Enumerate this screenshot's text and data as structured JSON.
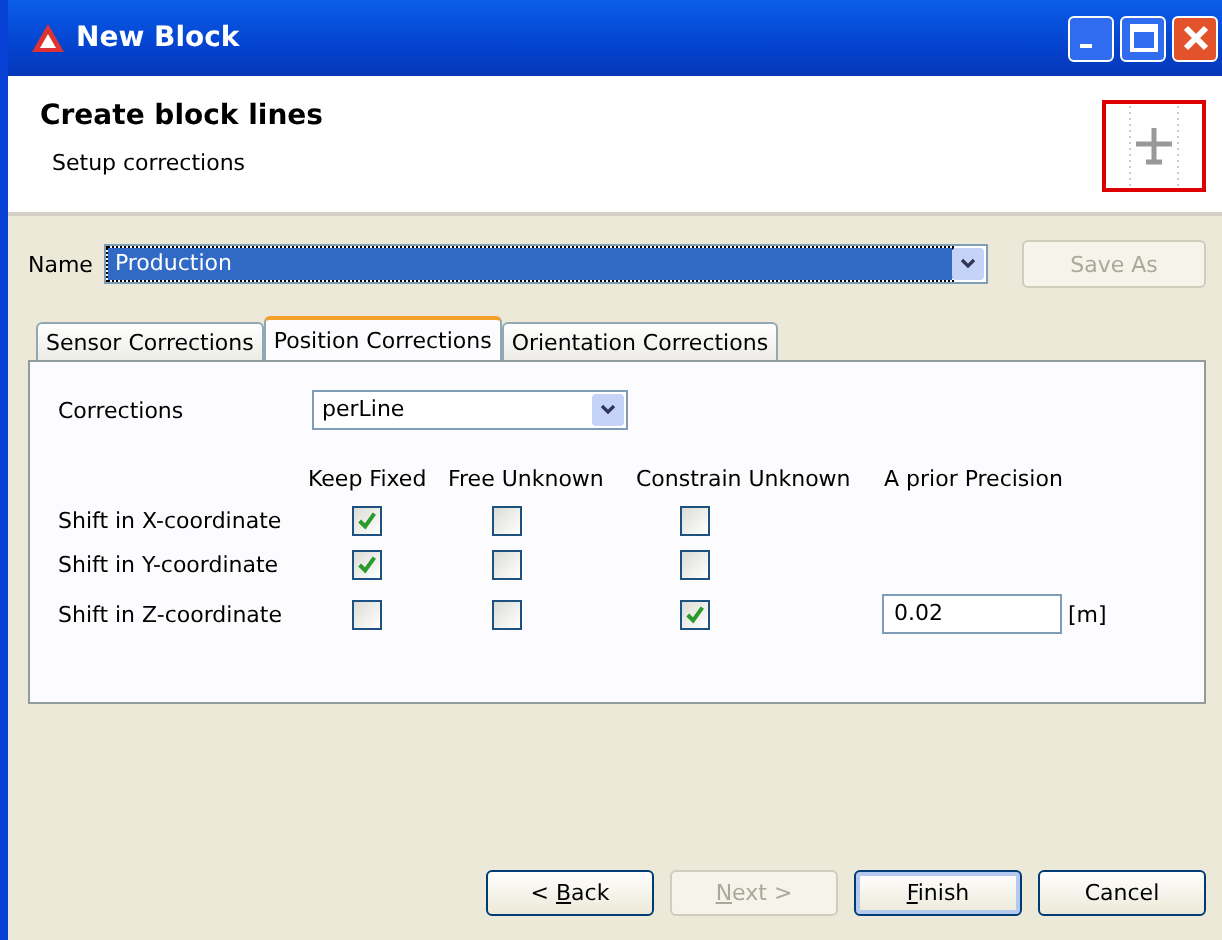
{
  "window": {
    "title": "New Block"
  },
  "header": {
    "title": "Create block lines",
    "subtitle": "Setup corrections"
  },
  "name_field": {
    "label": "Name",
    "value": "Production",
    "save_button": {
      "label": "Save As",
      "disabled": true
    }
  },
  "tabs": [
    {
      "label": "Sensor Corrections",
      "selected": false
    },
    {
      "label": "Position Corrections",
      "selected": true
    },
    {
      "label": "Orientation Corrections",
      "selected": false
    }
  ],
  "corrections": {
    "label": "Corrections",
    "value": "perLine"
  },
  "columns": [
    "Keep Fixed",
    "Free Unknown",
    "Constrain Unknown",
    "A prior Precision"
  ],
  "rows": [
    {
      "label": "Shift in X-coordinate",
      "keep_fixed": true,
      "free_unknown": false,
      "constrain_unknown": false
    },
    {
      "label": "Shift in Y-coordinate",
      "keep_fixed": true,
      "free_unknown": false,
      "constrain_unknown": false
    },
    {
      "label": "Shift in Z-coordinate",
      "keep_fixed": false,
      "free_unknown": false,
      "constrain_unknown": true,
      "precision": "0.02",
      "unit": "[m]"
    }
  ],
  "buttons": [
    {
      "before": "< ",
      "mnemonic": "B",
      "after": "ack",
      "disabled": false,
      "default": false
    },
    {
      "mnemonic": "N",
      "after": "ext >",
      "disabled": true,
      "default": false
    },
    {
      "mnemonic": "F",
      "after": "inish",
      "disabled": false,
      "default": true
    },
    {
      "before": "Cancel",
      "disabled": false,
      "default": false
    }
  ]
}
